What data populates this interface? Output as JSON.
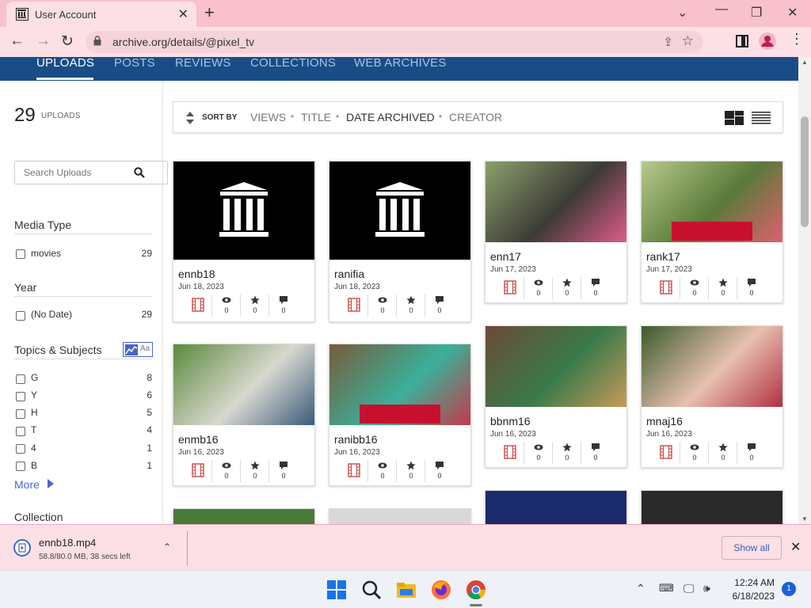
{
  "browser": {
    "tab_title": "User Account",
    "url": "archive.org/details/@pixel_tv"
  },
  "nav": {
    "tabs": [
      "UPLOADS",
      "POSTS",
      "REVIEWS",
      "COLLECTIONS",
      "WEB ARCHIVES"
    ],
    "active": "UPLOADS"
  },
  "sidebar": {
    "count": "29",
    "count_label": "UPLOADS",
    "search_placeholder": "Search Uploads",
    "media_type": {
      "title": "Media Type",
      "items": [
        {
          "label": "movies",
          "count": "29"
        }
      ]
    },
    "year": {
      "title": "Year",
      "items": [
        {
          "label": "(No Date)",
          "count": "29"
        }
      ]
    },
    "topics": {
      "title": "Topics & Subjects",
      "viz_label": "Aa",
      "items": [
        {
          "label": "G",
          "count": "8"
        },
        {
          "label": "Y",
          "count": "6"
        },
        {
          "label": "H",
          "count": "5"
        },
        {
          "label": "T",
          "count": "4"
        },
        {
          "label": "4",
          "count": "1"
        },
        {
          "label": "B",
          "count": "1"
        }
      ]
    },
    "more": "More",
    "collection_title": "Collection"
  },
  "sortbar": {
    "label": "SORT BY",
    "options": [
      "VIEWS",
      "TITLE",
      "DATE ARCHIVED",
      "CREATOR"
    ],
    "selected": "DATE ARCHIVED"
  },
  "items": [
    {
      "title": "ennb18",
      "date": "Jun 18, 2023",
      "views": "0",
      "favs": "0",
      "reviews": "0",
      "thumb": "archive-logo"
    },
    {
      "title": "ranifia",
      "date": "Jun 18, 2023",
      "views": "0",
      "favs": "0",
      "reviews": "0",
      "thumb": "archive-logo"
    },
    {
      "title": "enn17",
      "date": "Jun 17, 2023",
      "views": "0",
      "favs": "0",
      "reviews": "0",
      "thumb": "video-frame"
    },
    {
      "title": "rank17",
      "date": "Jun 17, 2023",
      "views": "0",
      "favs": "0",
      "reviews": "0",
      "thumb": "video-frame"
    },
    {
      "title": "enmb16",
      "date": "Jun 16, 2023",
      "views": "0",
      "favs": "0",
      "reviews": "0",
      "thumb": "video-frame"
    },
    {
      "title": "ranibb16",
      "date": "Jun 16, 2023",
      "views": "0",
      "favs": "0",
      "reviews": "0",
      "thumb": "video-frame"
    },
    {
      "title": "bbnm16",
      "date": "Jun 16, 2023",
      "views": "0",
      "favs": "0",
      "reviews": "0",
      "thumb": "video-frame"
    },
    {
      "title": "mnaj16",
      "date": "Jun 16, 2023",
      "views": "0",
      "favs": "0",
      "reviews": "0",
      "thumb": "video-frame"
    }
  ],
  "download": {
    "filename": "ennb18.mp4",
    "progress": "58.8/80.0 MB, 38 secs left",
    "show_all": "Show all"
  },
  "taskbar": {
    "time": "12:24 AM",
    "date": "6/18/2023",
    "notifications": "1"
  },
  "colors": {
    "nav_bg": "#194d87",
    "chrome_pink": "#f9c1cc",
    "link_blue": "#4b64c4",
    "media_red": "#c94a4a"
  }
}
